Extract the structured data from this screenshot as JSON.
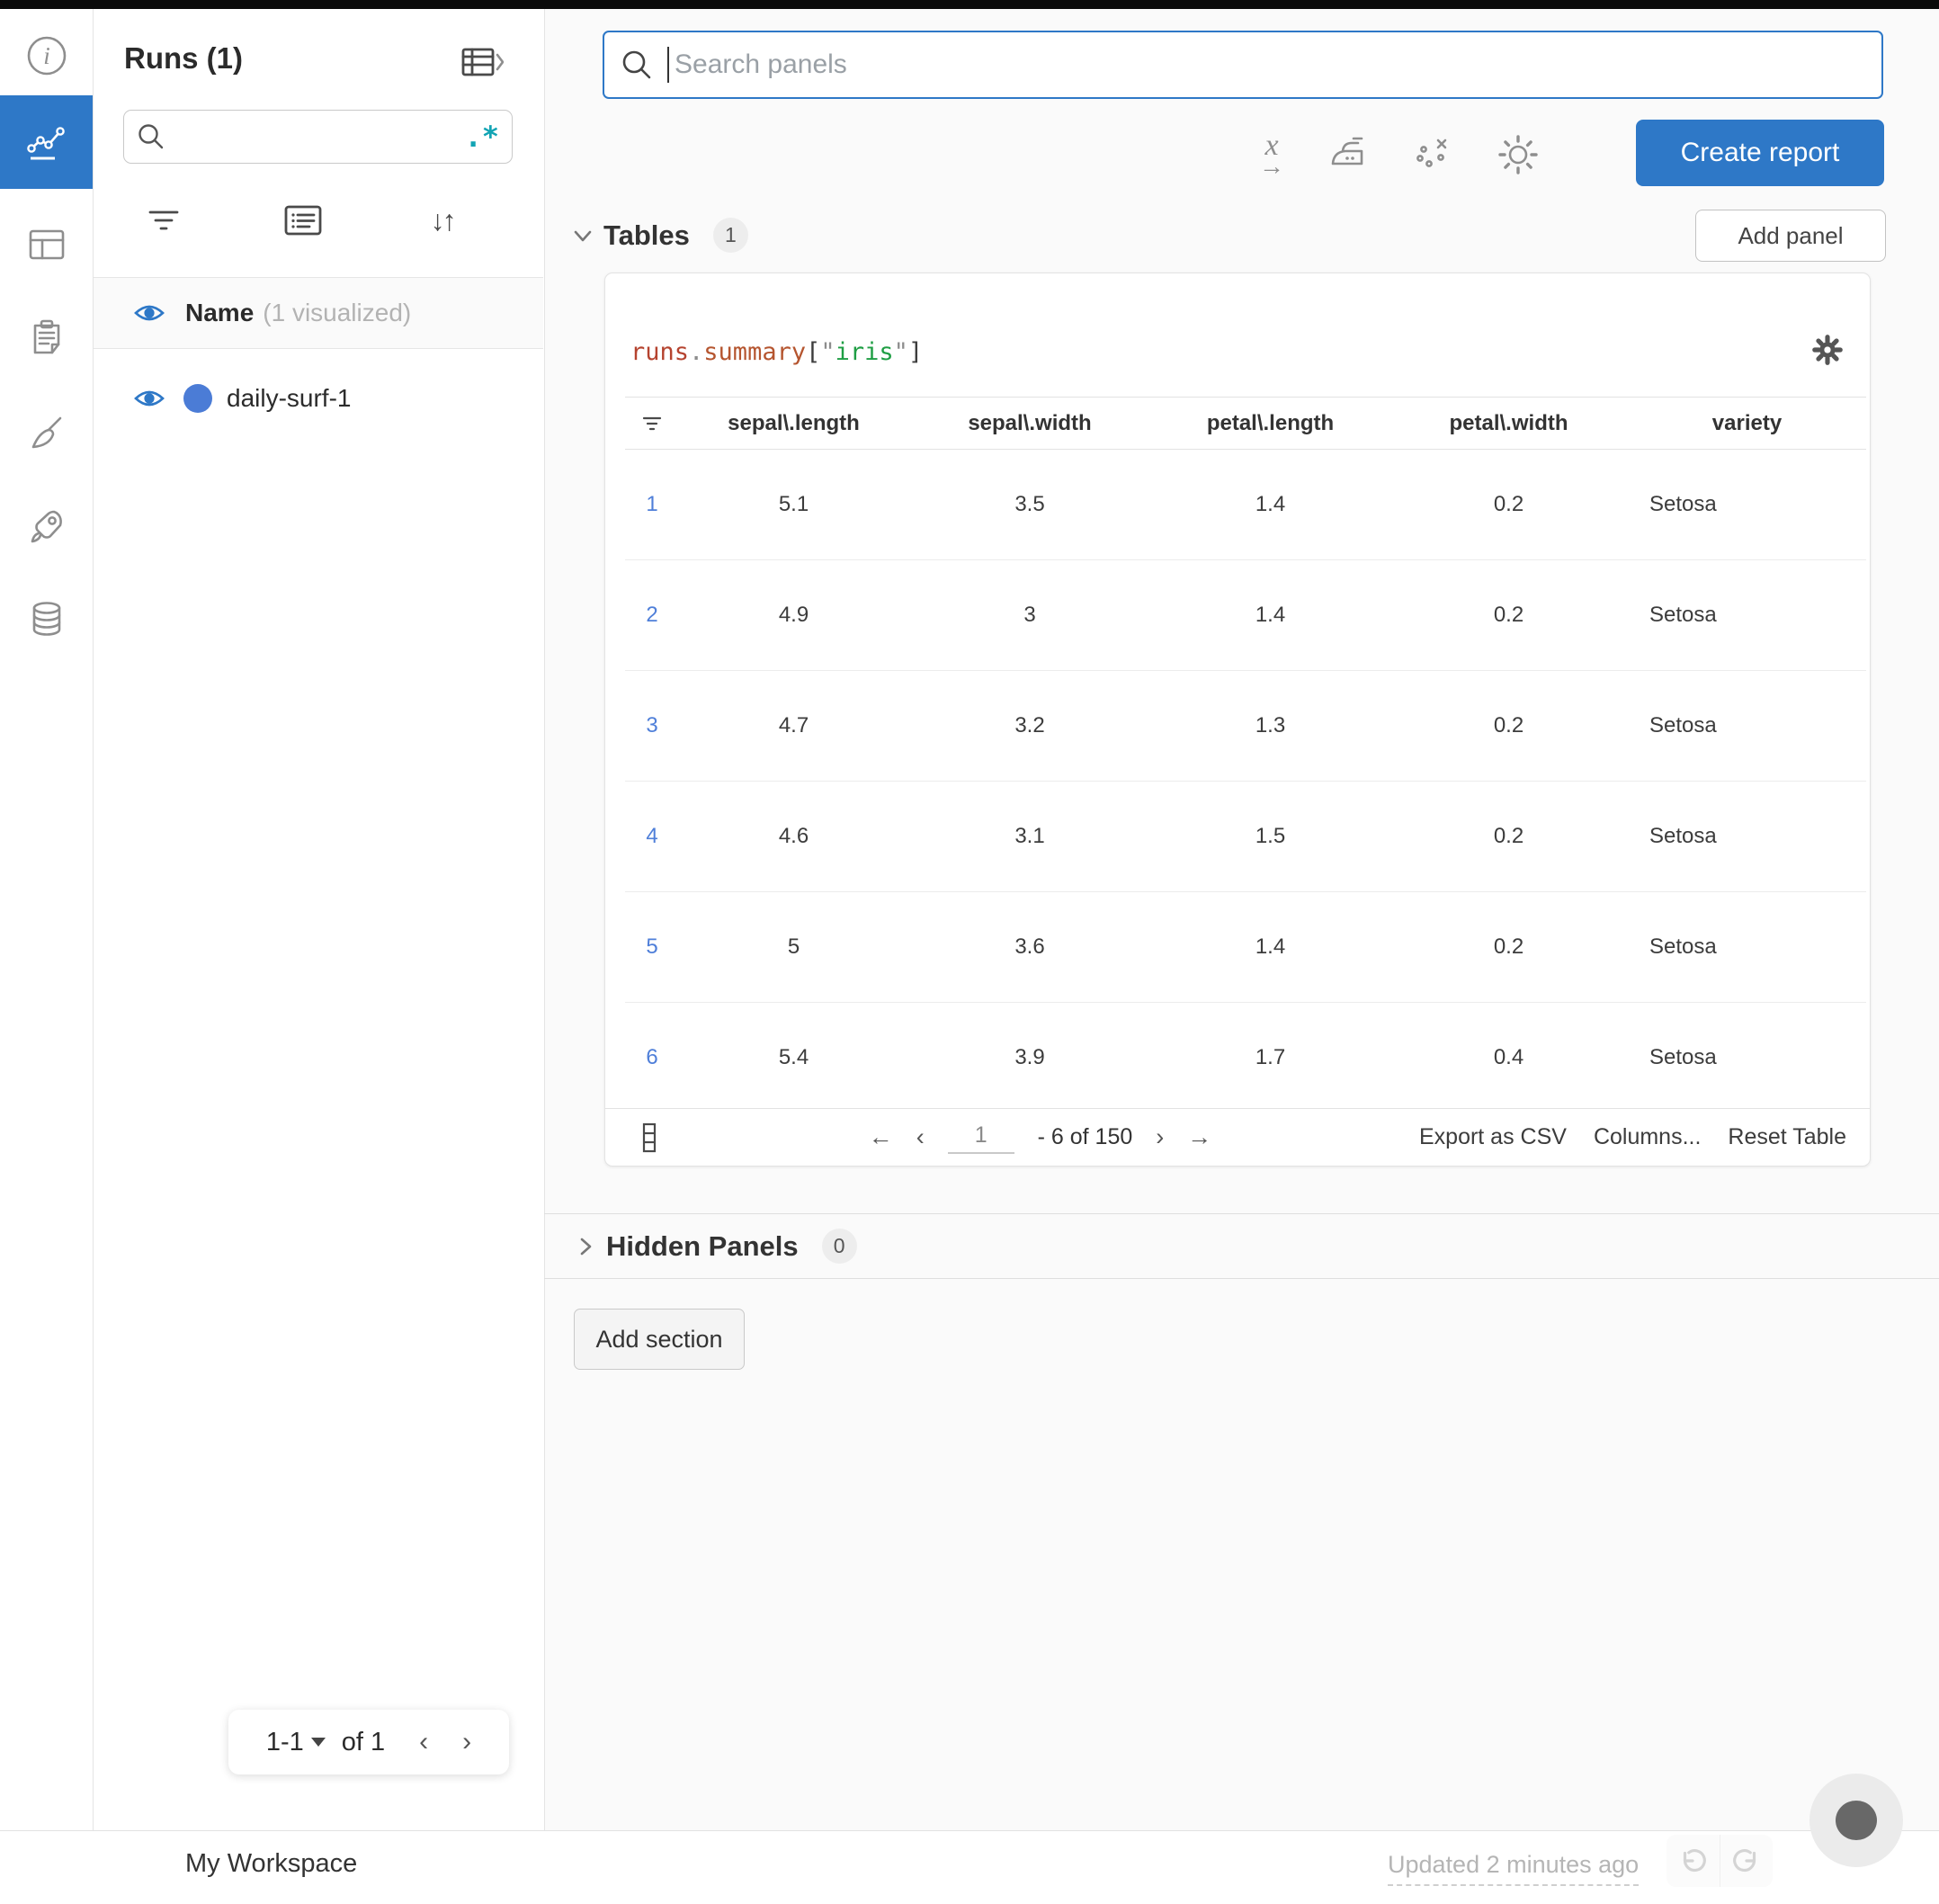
{
  "colors": {
    "accent": "#2e78c7",
    "run_dot": "#4b7cd6",
    "regex_teal": "#12a4b4",
    "row_index_blue": "#4f7fd9"
  },
  "icons": [
    "info-icon",
    "line-chart-icon",
    "panel-grid-icon",
    "clipboard-icon",
    "broom-icon",
    "rocket-icon",
    "database-icon",
    "search-icon",
    "regex-icon",
    "filter-icon",
    "notes-icon",
    "sort-icon",
    "eye-icon",
    "table-expand-icon",
    "x-axis-icon",
    "iron-icon",
    "outlier-icon",
    "gear-icon",
    "columns-icon",
    "undo-icon",
    "redo-icon",
    "chat-icon",
    "kebab-icon"
  ],
  "runs_panel": {
    "title": "Runs (1)",
    "search": {
      "placeholder": "",
      "regex": ".*"
    },
    "header": {
      "name": "Name",
      "note": "(1 visualized)"
    },
    "run": {
      "label": "daily-surf-1",
      "dot_color": "#4b7cd6"
    },
    "pagination": {
      "range": "1-1",
      "of": "of 1",
      "prev": "‹",
      "next": "›"
    }
  },
  "main": {
    "search": {
      "placeholder": "Search panels"
    },
    "create_report": "Create report",
    "add_panel": "Add panel",
    "tables_section": {
      "label": "Tables",
      "count": "1"
    },
    "hidden_section": {
      "label": "Hidden Panels",
      "count": "0"
    },
    "add_section": "Add section",
    "table_panel": {
      "title_parts": [
        {
          "text": "runs",
          "color": "#b5432f"
        },
        {
          "text": ".",
          "color": "#8d8d8d"
        },
        {
          "text": "summary",
          "color": "#b5552f"
        },
        {
          "text": "[",
          "color": "#3d3d3d"
        },
        {
          "text": "\"",
          "color": "#8d8d8d"
        },
        {
          "text": "iris",
          "color": "#1f9e44"
        },
        {
          "text": "\"",
          "color": "#8d8d8d"
        },
        {
          "text": "]",
          "color": "#3d3d3d"
        }
      ],
      "columns": [
        "sepal\\.length",
        "sepal\\.width",
        "petal\\.length",
        "petal\\.width",
        "variety"
      ],
      "rows": [
        {
          "index": "1",
          "values": [
            "5.1",
            "3.5",
            "1.4",
            "0.2"
          ],
          "variety": "Setosa"
        },
        {
          "index": "2",
          "values": [
            "4.9",
            "3",
            "1.4",
            "0.2"
          ],
          "variety": "Setosa"
        },
        {
          "index": "3",
          "values": [
            "4.7",
            "3.2",
            "1.3",
            "0.2"
          ],
          "variety": "Setosa"
        },
        {
          "index": "4",
          "values": [
            "4.6",
            "3.1",
            "1.5",
            "0.2"
          ],
          "variety": "Setosa"
        },
        {
          "index": "5",
          "values": [
            "5",
            "3.6",
            "1.4",
            "0.2"
          ],
          "variety": "Setosa"
        },
        {
          "index": "6",
          "values": [
            "5.4",
            "3.9",
            "1.7",
            "0.4"
          ],
          "variety": "Setosa"
        }
      ],
      "footer": {
        "arrow_first": "←",
        "arrow_prev": "‹",
        "page": "1",
        "range": "- 6 of 150",
        "arrow_next": "›",
        "arrow_last": "→",
        "export": "Export as CSV",
        "columns": "Columns...",
        "reset": "Reset Table"
      }
    }
  },
  "bottom_bar": {
    "workspace": "My Workspace",
    "updated": "Updated 2 minutes ago"
  }
}
